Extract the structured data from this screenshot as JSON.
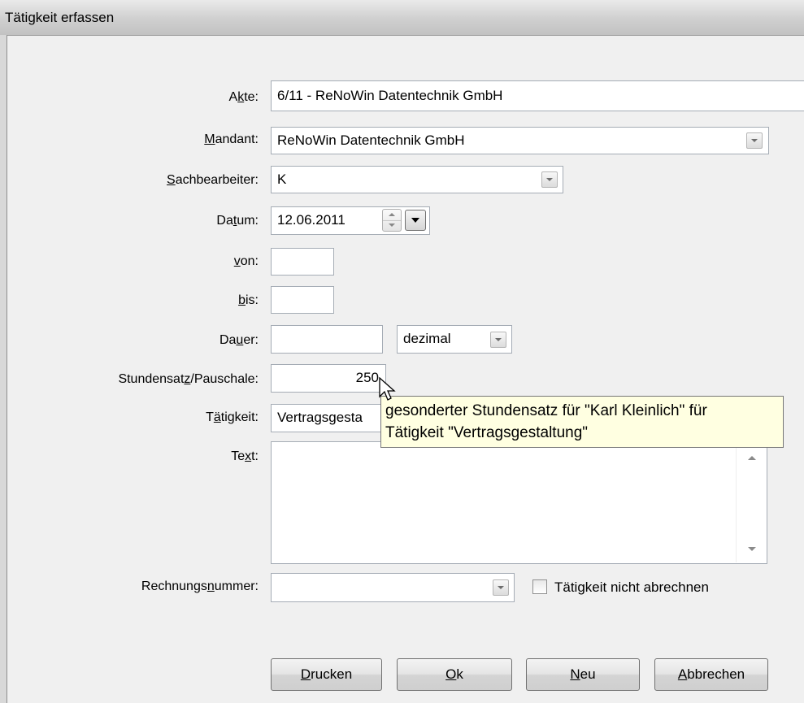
{
  "window": {
    "title": "Tätigkeit erfassen"
  },
  "form": {
    "akte": {
      "label_pre": "A",
      "label_u": "k",
      "label_post": "te:",
      "value": "6/11  -  ReNoWin Datentechnik GmbH"
    },
    "mandant": {
      "label_pre": "",
      "label_u": "M",
      "label_post": "andant:",
      "value": "ReNoWin Datentechnik GmbH"
    },
    "sachbearbeiter": {
      "label_pre": "",
      "label_u": "S",
      "label_post": "achbearbeiter:",
      "value": "K"
    },
    "datum": {
      "label_pre": "Da",
      "label_u": "t",
      "label_post": "um:",
      "value": "12.06.2011"
    },
    "von": {
      "label_pre": "",
      "label_u": "v",
      "label_post": "on:",
      "value": ""
    },
    "bis": {
      "label_pre": "",
      "label_u": "b",
      "label_post": "is:",
      "value": ""
    },
    "dauer": {
      "label_pre": "Da",
      "label_u": "u",
      "label_post": "er:",
      "value": "",
      "unit": "dezimal"
    },
    "stundensatz": {
      "label_pre": "Stundensat",
      "label_u": "z",
      "label_post": "/Pauschale:",
      "value": "250"
    },
    "taetigkeit": {
      "label_pre": "T",
      "label_u": "ä",
      "label_post": "tigkeit:",
      "value": "Vertragsgesta"
    },
    "text": {
      "label_pre": "Te",
      "label_u": "x",
      "label_post": "t:",
      "value": ""
    },
    "rechnungsnummer": {
      "label_pre": "Rechnungs",
      "label_u": "n",
      "label_post": "ummer:",
      "value": ""
    },
    "nicht_abrechnen": {
      "label": "Tätigkeit nicht abrechnen",
      "checked": false
    }
  },
  "tooltip": {
    "line1": "gesonderter Stundensatz für \"Karl Kleinlich\" für",
    "line2": "Tätigkeit \"Vertragsgestaltung\""
  },
  "buttons": {
    "drucken": {
      "u": "D",
      "rest": "rucken"
    },
    "ok": {
      "u": "O",
      "rest": "k"
    },
    "neu": {
      "u": "N",
      "rest": "eu"
    },
    "abbrechen": {
      "u": "A",
      "rest": "bbrechen"
    }
  }
}
